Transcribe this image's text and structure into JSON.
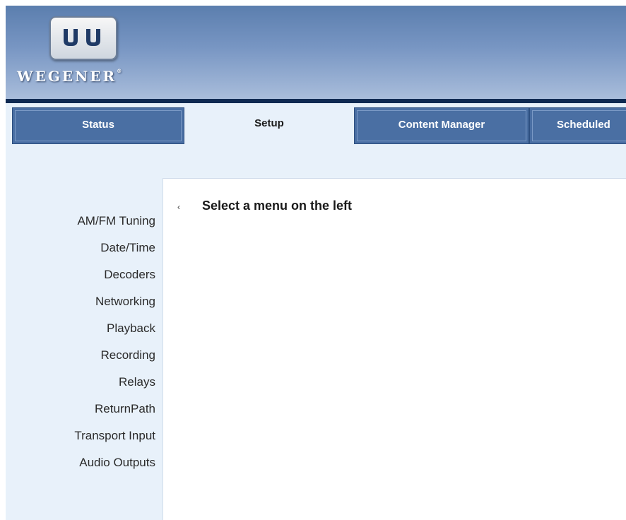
{
  "header": {
    "logo_text": "WEGENER",
    "logo_mark": "UU"
  },
  "tabs": [
    {
      "label": "Status",
      "active": false
    },
    {
      "label": "Setup",
      "active": true
    },
    {
      "label": "Content Manager",
      "active": false
    },
    {
      "label": "Scheduled",
      "active": false
    }
  ],
  "sidebar": {
    "items": [
      {
        "label": "AM/FM Tuning"
      },
      {
        "label": "Date/Time"
      },
      {
        "label": "Decoders"
      },
      {
        "label": "Networking"
      },
      {
        "label": "Playback"
      },
      {
        "label": "Recording"
      },
      {
        "label": "Relays"
      },
      {
        "label": "ReturnPath"
      },
      {
        "label": "Transport Input"
      },
      {
        "label": "Audio Outputs"
      }
    ]
  },
  "content": {
    "bullet": "‹",
    "message": "Select a menu on the left"
  },
  "colors": {
    "header_top": "#5b7eae",
    "tab_bg": "#4a6fa3",
    "page_bg": "#e8f1fa",
    "header_rule": "#0f2a52"
  }
}
